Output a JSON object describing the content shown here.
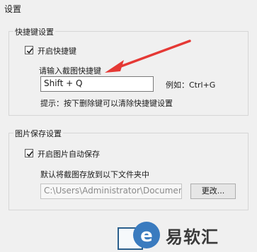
{
  "window": {
    "title": "设置"
  },
  "shortcut_group": {
    "legend": "快捷键设置",
    "enable_label": "开启快捷键",
    "enable_checked": true,
    "prompt": "请输入截图快捷键",
    "input_value": "Shift + Q",
    "example": "例如：Ctrl+G",
    "hint": "提示：按下删除键可以清除快捷键设置"
  },
  "save_group": {
    "legend": "图片保存设置",
    "auto_save_label": "开启图片自动保存",
    "auto_save_checked": true,
    "folder_prompt": "默认将截图存放到以下文件夹中",
    "path_value": "C:\\Users\\Administrator\\Documer",
    "change_button": "更改..."
  },
  "watermark": {
    "brand_text": "易软汇",
    "arrow_color": "#e53935"
  }
}
